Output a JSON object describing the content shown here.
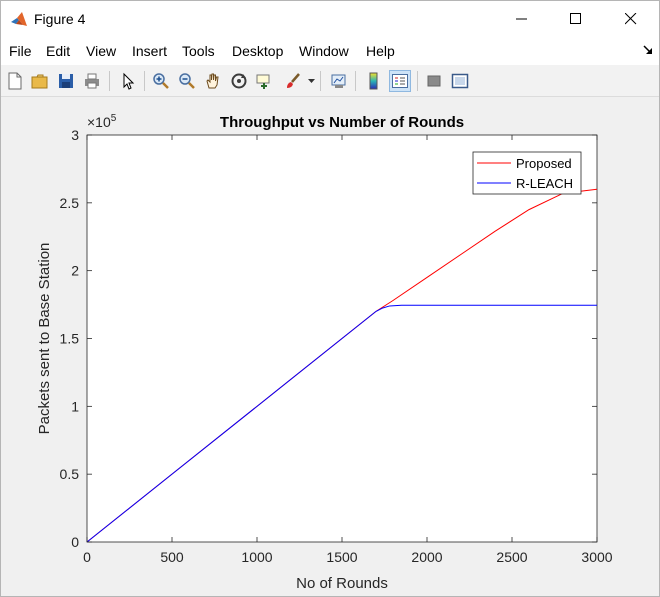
{
  "window": {
    "title": "Figure 4",
    "controls": [
      "minimize",
      "maximize",
      "close"
    ]
  },
  "menu": {
    "items": [
      "File",
      "Edit",
      "View",
      "Insert",
      "Tools",
      "Desktop",
      "Window",
      "Help"
    ]
  },
  "toolbar": {
    "buttons": [
      {
        "name": "new-figure-icon"
      },
      {
        "name": "open-file-icon"
      },
      {
        "name": "save-icon"
      },
      {
        "name": "print-icon"
      },
      {
        "name": "pointer-icon"
      },
      {
        "name": "zoom-in-icon"
      },
      {
        "name": "zoom-out-icon"
      },
      {
        "name": "pan-hand-icon"
      },
      {
        "name": "rotate-3d-icon"
      },
      {
        "name": "data-cursor-icon"
      },
      {
        "name": "brush-icon"
      },
      {
        "name": "link-plot-icon"
      },
      {
        "name": "insert-colorbar-icon"
      },
      {
        "name": "insert-legend-icon"
      },
      {
        "name": "hide-plot-tools-icon"
      },
      {
        "name": "show-plot-tools-icon"
      }
    ]
  },
  "colors": {
    "proposed": "#ff0000",
    "rleach": "#0000ff"
  },
  "chart_data": {
    "type": "line",
    "title": "Throughput vs Number of Rounds",
    "xlabel": "No of Rounds",
    "ylabel": "Packets sent to Base Station",
    "y_exponent_label": "×10",
    "y_exponent": "5",
    "xlim": [
      0,
      3000
    ],
    "ylim": [
      0,
      3
    ],
    "xticks": [
      "0",
      "500",
      "1000",
      "1500",
      "2000",
      "2500",
      "3000"
    ],
    "yticks": [
      "0",
      "0.5",
      "1",
      "1.5",
      "2",
      "2.5",
      "3"
    ],
    "legend_position": "top-right",
    "grid": false,
    "series": [
      {
        "name": "Proposed",
        "x": [
          0,
          500,
          1000,
          1500,
          1700,
          1800,
          2000,
          2200,
          2400,
          2600,
          2800,
          3000
        ],
        "y": [
          0,
          0.5,
          1.0,
          1.5,
          1.7,
          1.78,
          1.95,
          2.12,
          2.29,
          2.45,
          2.57,
          2.6
        ]
      },
      {
        "name": "R-LEACH",
        "x": [
          0,
          500,
          1000,
          1500,
          1700,
          1740,
          1780,
          1850,
          2000,
          2500,
          3000
        ],
        "y": [
          0,
          0.5,
          1.0,
          1.5,
          1.7,
          1.725,
          1.74,
          1.745,
          1.745,
          1.745,
          1.745
        ]
      }
    ]
  }
}
